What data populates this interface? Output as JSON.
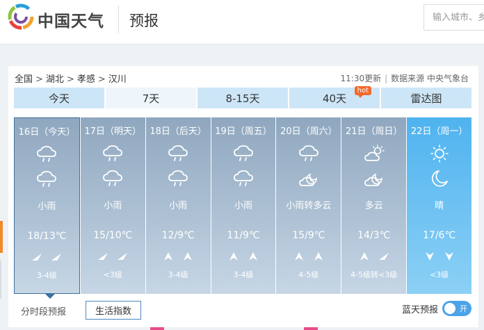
{
  "header": {
    "brand": "中国天气",
    "section": "预报",
    "search_placeholder": "输入城市、乡"
  },
  "breadcrumb": [
    "全国",
    "湖北",
    "孝感",
    "汉川"
  ],
  "meta": {
    "update": "11:30更新",
    "source": "数据来源 中央气象台"
  },
  "tabs": [
    {
      "label": "今天"
    },
    {
      "label": "7天",
      "active": true
    },
    {
      "label": "8-15天"
    },
    {
      "label": "40天",
      "badge": "hot"
    },
    {
      "label": "雷达图"
    }
  ],
  "days": [
    {
      "date": "16日（今天）",
      "icon_day": "rain",
      "icon_night": "rain",
      "weather": "小雨",
      "temp": "18/13℃",
      "wind": [
        "wind-ne",
        "wind-ne"
      ],
      "level": "3-4级",
      "selected": true
    },
    {
      "date": "17日（明天）",
      "icon_day": "rain",
      "icon_night": "rain",
      "weather": "小雨",
      "temp": "15/10℃",
      "wind": [
        "wind-ne",
        "wind-ne"
      ],
      "level": "<3级"
    },
    {
      "date": "18日（后天）",
      "icon_day": "rain",
      "icon_night": "rain",
      "weather": "小雨",
      "temp": "12/9℃",
      "wind": [
        "wind-n",
        "wind-n"
      ],
      "level": "3-4级"
    },
    {
      "date": "19日（周五）",
      "icon_day": "rain",
      "icon_night": "rain",
      "weather": "小雨",
      "temp": "11/9℃",
      "wind": [
        "wind-n",
        "wind-n"
      ],
      "level": "3-4级"
    },
    {
      "date": "20日（周六）",
      "icon_day": "rain",
      "icon_night": "cloudy-night",
      "weather": "小雨转多云",
      "temp": "15/9℃",
      "wind": [
        "wind-n",
        "wind-n"
      ],
      "level": "4-5级"
    },
    {
      "date": "21日（周日）",
      "icon_day": "cloudy-day",
      "icon_night": "cloudy-night",
      "weather": "多云",
      "temp": "14/3℃",
      "wind": [
        "wind-n",
        "wind-ne"
      ],
      "level": "4-5级转<3级"
    },
    {
      "date": "22日（周一）",
      "icon_day": "sunny",
      "icon_night": "moon",
      "weather": "晴",
      "temp": "17/6℃",
      "wind": [
        "wind-s",
        "wind-s"
      ],
      "level": "<3级",
      "clear": true
    }
  ],
  "footer": {
    "hourly_link": "分时段预报",
    "life_index": "生活指数",
    "blue_sky": "蓝天预报",
    "toggle_label": "开"
  },
  "colors": {
    "tab_bg": "#cde6f7",
    "day_card_top": "#8fa7bf",
    "clear_card_top": "#4fb3ef",
    "toggle_on": "#4ba3e8",
    "hot_badge": "#f26b2b"
  }
}
